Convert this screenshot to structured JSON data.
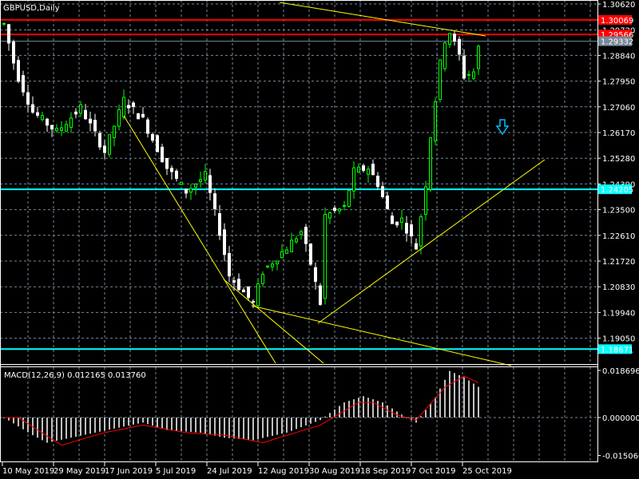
{
  "chart_data": {
    "type": "candlestick",
    "title": "GBPUSD,Daily",
    "price_ticks": [
      "1.30620",
      "1.29720",
      "1.28840",
      "1.27950",
      "1.27060",
      "1.26170",
      "1.25280",
      "1.24390",
      "1.23500",
      "1.22610",
      "1.21720",
      "1.20830",
      "1.19940",
      "1.19050"
    ],
    "price_ticks_values": [
      1.3062,
      1.2972,
      1.2884,
      1.2795,
      1.2706,
      1.2617,
      1.2528,
      1.2439,
      1.235,
      1.2261,
      1.2172,
      1.2083,
      1.1994,
      1.1905
    ],
    "ylim": [
      1.1805,
      1.3075
    ],
    "date_labels": [
      "10 May 2019",
      "29 May 2019",
      "17 Jun 2019",
      "5 Jul 2019",
      "24 Jul 2019",
      "12 Aug 2019",
      "30 Aug 2019",
      "18 Sep 2019",
      "7 Oct 2019",
      "25 Oct 2019"
    ],
    "bars": 100,
    "close_path": [
      [
        0,
        1.2993
      ],
      [
        2.5,
        1.2827
      ],
      [
        6,
        1.2689
      ],
      [
        11,
        1.262
      ],
      [
        16,
        1.2703
      ],
      [
        21,
        1.2551
      ],
      [
        25,
        1.273
      ],
      [
        29,
        1.2661
      ],
      [
        34,
        1.2495
      ],
      [
        38,
        1.2413
      ],
      [
        42,
        1.2468
      ],
      [
        45,
        1.2274
      ],
      [
        47,
        1.2122
      ],
      [
        52,
        1.2026
      ],
      [
        54,
        1.2136
      ],
      [
        59,
        1.2219
      ],
      [
        62,
        1.2274
      ],
      [
        64,
        1.2164
      ],
      [
        66,
        1.2026
      ],
      [
        67,
        1.233
      ],
      [
        71,
        1.2357
      ],
      [
        73,
        1.2482
      ],
      [
        76,
        1.2495
      ],
      [
        78,
        1.244
      ],
      [
        81,
        1.2302
      ],
      [
        83,
        1.2316
      ],
      [
        86,
        1.2219
      ],
      [
        88,
        1.244
      ],
      [
        89,
        1.2606
      ],
      [
        91,
        1.2855
      ],
      [
        92,
        1.2938
      ],
      [
        93,
        1.2965
      ],
      [
        95,
        1.2883
      ],
      [
        96,
        1.2813
      ],
      [
        98,
        1.2827
      ],
      [
        99,
        1.291
      ]
    ],
    "levels": [
      {
        "label": "1.30069",
        "value": 1.30069,
        "color": "#ff0000"
      },
      {
        "label": "1.29566",
        "value": 1.29566,
        "color": "#ff0000"
      },
      {
        "label": "1.29332",
        "value": 1.29332,
        "color": "#778899"
      },
      {
        "label": "1.24205",
        "value": 1.24205,
        "color": "#00ffff"
      },
      {
        "label": "1.18671",
        "value": 1.18671,
        "color": "#00ffff"
      }
    ],
    "macd": {
      "label": "MACD(12,26,9) 0.012165 0.013760",
      "ticks": [
        "0.018696",
        "0.000000",
        "-0.015060"
      ],
      "ticks_values": [
        0.018696,
        0,
        -0.01506
      ],
      "histogram_path": [
        [
          0,
          0
        ],
        [
          6,
          -0.007
        ],
        [
          9,
          -0.01
        ],
        [
          19,
          -0.006
        ],
        [
          29,
          -0.002
        ],
        [
          34,
          -0.005
        ],
        [
          41,
          -0.006
        ],
        [
          46,
          -0.008
        ],
        [
          52,
          -0.009
        ],
        [
          59,
          -0.006
        ],
        [
          66,
          -0.001
        ],
        [
          71,
          0.006
        ],
        [
          75,
          0.0085
        ],
        [
          79,
          0.006
        ],
        [
          84,
          0
        ],
        [
          86,
          -0.002
        ],
        [
          90,
          0.008
        ],
        [
          93,
          0.0185
        ],
        [
          96,
          0.016
        ],
        [
          99,
          0.0122
        ]
      ],
      "signal_path": [
        [
          0,
          0
        ],
        [
          3,
          0
        ],
        [
          12,
          -0.011
        ],
        [
          21,
          -0.006
        ],
        [
          29,
          -0.003
        ],
        [
          38,
          -0.006
        ],
        [
          46,
          -0.007
        ],
        [
          54,
          -0.01
        ],
        [
          66,
          -0.003
        ],
        [
          74,
          0.006
        ],
        [
          77,
          0.006
        ],
        [
          82,
          0.001
        ],
        [
          86,
          -0.001
        ],
        [
          92,
          0.012
        ],
        [
          96,
          0.0165
        ],
        [
          99,
          0.0138
        ]
      ]
    },
    "colors": {
      "up": "#00ff00",
      "down": "#ffffff",
      "grid": "#778899",
      "trend": "#ffff00",
      "macd_hist": "#c0c0c0",
      "signal": "#ff0000",
      "arrow": "#00bfff"
    }
  }
}
